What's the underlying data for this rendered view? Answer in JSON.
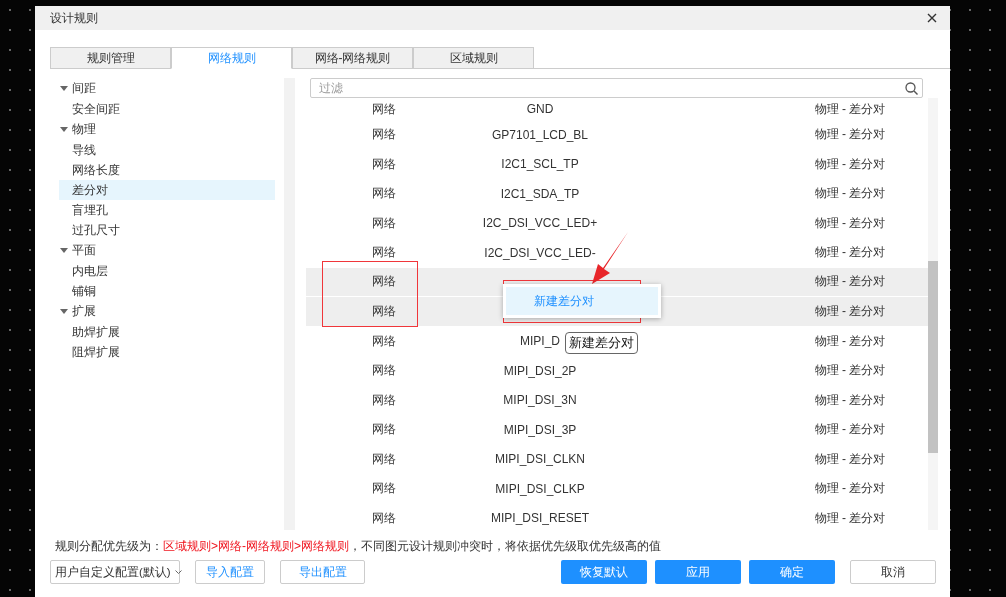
{
  "window": {
    "title": "设计规则"
  },
  "tabs": [
    {
      "label": "规则管理",
      "selected": false
    },
    {
      "label": "网络规则",
      "selected": true
    },
    {
      "label": "网络-网络规则",
      "selected": false
    },
    {
      "label": "区域规则",
      "selected": false
    }
  ],
  "tree": [
    {
      "label": "间距",
      "expanded": true,
      "children": [
        {
          "label": "安全间距",
          "selected": false
        }
      ]
    },
    {
      "label": "物理",
      "expanded": true,
      "children": [
        {
          "label": "导线",
          "selected": false
        },
        {
          "label": "网络长度",
          "selected": false
        },
        {
          "label": "差分对",
          "selected": true
        },
        {
          "label": "盲埋孔",
          "selected": false
        },
        {
          "label": "过孔尺寸",
          "selected": false
        }
      ]
    },
    {
      "label": "平面",
      "expanded": true,
      "children": [
        {
          "label": "内电层",
          "selected": false
        },
        {
          "label": "铺铜",
          "selected": false
        }
      ]
    },
    {
      "label": "扩展",
      "expanded": true,
      "children": [
        {
          "label": "助焊扩展",
          "selected": false
        },
        {
          "label": "阻焊扩展",
          "selected": false
        }
      ]
    }
  ],
  "filter": {
    "placeholder": "过滤"
  },
  "rows": [
    {
      "type": "网络",
      "name": "GND",
      "rule": "物理 - 差分对",
      "selected": false
    },
    {
      "type": "网络",
      "name": "GP7101_LCD_BL",
      "rule": "物理 - 差分对",
      "selected": false
    },
    {
      "type": "网络",
      "name": "I2C1_SCL_TP",
      "rule": "物理 - 差分对",
      "selected": false
    },
    {
      "type": "网络",
      "name": "I2C1_SDA_TP",
      "rule": "物理 - 差分对",
      "selected": false
    },
    {
      "type": "网络",
      "name": "I2C_DSI_VCC_LED+",
      "rule": "物理 - 差分对",
      "selected": false
    },
    {
      "type": "网络",
      "name": "I2C_DSI_VCC_LED-",
      "rule": "物理 - 差分对",
      "selected": false
    },
    {
      "type": "网络",
      "rule": "物理 - 差分对",
      "selected": true
    },
    {
      "type": "网络",
      "rule": "物理 - 差分对",
      "selected": true
    },
    {
      "type": "网络",
      "name": "MIPI_D",
      "rule": "物理 - 差分对",
      "selected": false
    },
    {
      "type": "网络",
      "name": "MIPI_DSI_2P",
      "rule": "物理 - 差分对",
      "selected": false
    },
    {
      "type": "网络",
      "name": "MIPI_DSI_3N",
      "rule": "物理 - 差分对",
      "selected": false
    },
    {
      "type": "网络",
      "name": "MIPI_DSI_3P",
      "rule": "物理 - 差分对",
      "selected": false
    },
    {
      "type": "网络",
      "name": "MIPI_DSI_CLKN",
      "rule": "物理 - 差分对",
      "selected": false
    },
    {
      "type": "网络",
      "name": "MIPI_DSI_CLKP",
      "rule": "物理 - 差分对",
      "selected": false
    },
    {
      "type": "网络",
      "name": "MIPI_DSI_RESET",
      "rule": "物理 - 差分对",
      "selected": false
    }
  ],
  "context_menu": {
    "items": [
      {
        "label": "新建差分对",
        "selected": true
      }
    ]
  },
  "tooltip": "新建差分对",
  "annotations": [
    {
      "kind": "box"
    },
    {
      "kind": "box"
    },
    {
      "kind": "arrow"
    }
  ],
  "notice": {
    "prefix": "规则分配优先级为：",
    "highlight": "区域规则>网络-网络规则>网络规则",
    "suffix": "，不同图元设计规则冲突时，将依据优先级取优先级高的值"
  },
  "config_select": {
    "value": "用户自定义配置(默认)"
  },
  "buttons": [
    {
      "label": "导入配置",
      "kind": "outline"
    },
    {
      "label": "导出配置",
      "kind": "outline"
    },
    {
      "label": "恢复默认",
      "kind": "primary"
    },
    {
      "label": "应用",
      "kind": "primary"
    },
    {
      "label": "确定",
      "kind": "primary"
    },
    {
      "label": "取消",
      "kind": "plain"
    }
  ]
}
